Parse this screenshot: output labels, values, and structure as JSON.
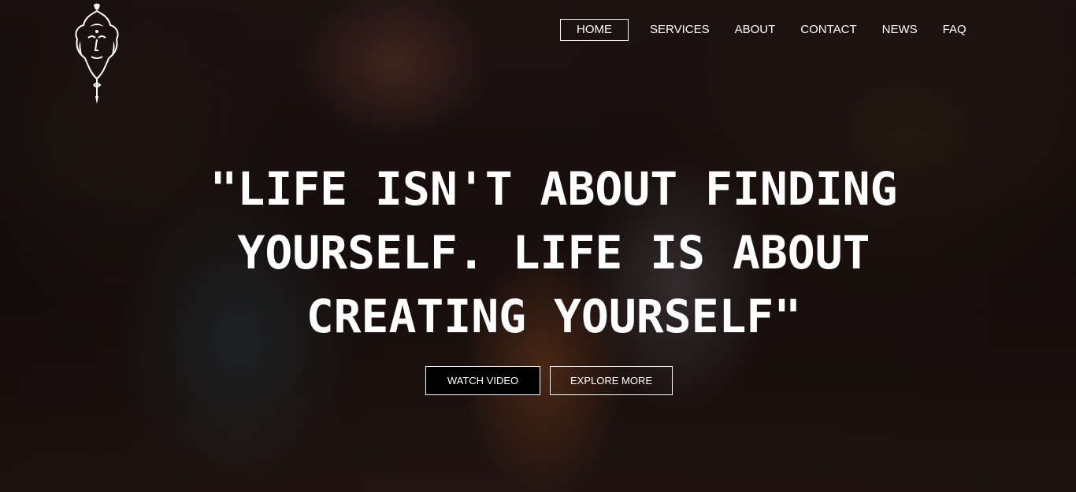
{
  "brand": {
    "logo_icon": "buddha-head-icon"
  },
  "nav": {
    "items": [
      {
        "label": "HOME",
        "active": true
      },
      {
        "label": "SERVICES",
        "active": false
      },
      {
        "label": "ABOUT",
        "active": false
      },
      {
        "label": "CONTACT",
        "active": false
      },
      {
        "label": "NEWS",
        "active": false
      },
      {
        "label": "FAQ",
        "active": false
      }
    ]
  },
  "hero": {
    "quote_lines": [
      "\"LIFE ISN'T ABOUT FINDING",
      "YOURSELF. LIFE IS ABOUT",
      "CREATING YOURSELF\""
    ],
    "buttons": {
      "watch_video": "WATCH VIDEO",
      "explore_more": "EXPLORE MORE"
    }
  },
  "colors": {
    "text": "#ffffff",
    "primary_button_bg": "#000000",
    "overlay": "#1a1110"
  }
}
